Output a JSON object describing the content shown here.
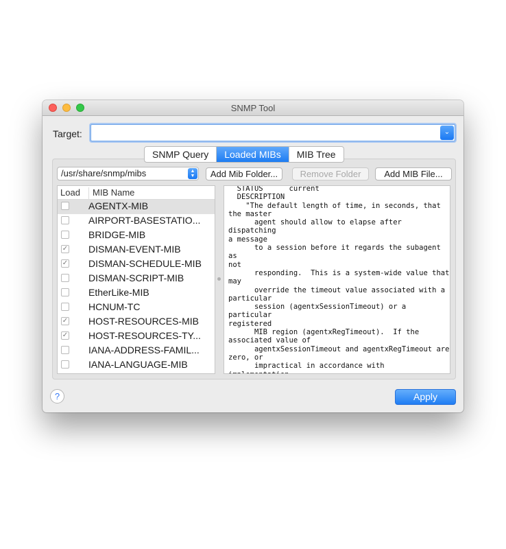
{
  "window": {
    "title": "SNMP Tool"
  },
  "target": {
    "label": "Target:",
    "value": ""
  },
  "tabs": [
    {
      "label": "SNMP Query",
      "active": false
    },
    {
      "label": "Loaded MIBs",
      "active": true
    },
    {
      "label": "MIB Tree",
      "active": false
    }
  ],
  "toolbar": {
    "path": "/usr/share/snmp/mibs",
    "add_folder": "Add Mib Folder...",
    "remove_folder": "Remove Folder",
    "add_file": "Add MIB File..."
  },
  "list": {
    "col_load": "Load",
    "col_name": "MIB Name",
    "rows": [
      {
        "name": "AGENTX-MIB",
        "checked": false,
        "selected": true
      },
      {
        "name": "AIRPORT-BASESTATIO...",
        "checked": false,
        "selected": false
      },
      {
        "name": "BRIDGE-MIB",
        "checked": false,
        "selected": false
      },
      {
        "name": "DISMAN-EVENT-MIB",
        "checked": true,
        "selected": false
      },
      {
        "name": "DISMAN-SCHEDULE-MIB",
        "checked": true,
        "selected": false
      },
      {
        "name": "DISMAN-SCRIPT-MIB",
        "checked": false,
        "selected": false
      },
      {
        "name": "EtherLike-MIB",
        "checked": false,
        "selected": false
      },
      {
        "name": "HCNUM-TC",
        "checked": false,
        "selected": false
      },
      {
        "name": "HOST-RESOURCES-MIB",
        "checked": true,
        "selected": false
      },
      {
        "name": "HOST-RESOURCES-TY...",
        "checked": true,
        "selected": false
      },
      {
        "name": "IANA-ADDRESS-FAMIL...",
        "checked": false,
        "selected": false
      },
      {
        "name": "IANA-LANGUAGE-MIB",
        "checked": false,
        "selected": false
      }
    ]
  },
  "description": "  STATUS      current\n  DESCRIPTION\n    \"The default length of time, in seconds, that\nthe master\n      agent should allow to elapse after dispatching\na message\n      to a session before it regards the subagent as\nnot\n      responding.  This is a system-wide value that\nmay\n      override the timeout value associated with a\nparticular\n      session (agentxSessionTimeout) or a particular\nregistered\n      MIB region (agentxRegTimeout).  If the\nassociated value of\n      agentxSessionTimeout and agentxRegTimeout are\nzero, or\n      impractical in accordance with implementation-\nspecific\n      procedure of the master agent, the value\nrepresented by\n      this object will be the effective timeout value",
  "footer": {
    "help": "?",
    "apply": "Apply"
  },
  "icons": {
    "dropdown": "chevron-down-icon",
    "stepper": "up-down-chevron-icon",
    "check": "checkmark-icon"
  },
  "colors": {
    "accent": "#1d7cf2",
    "window_bg": "#ececec"
  }
}
